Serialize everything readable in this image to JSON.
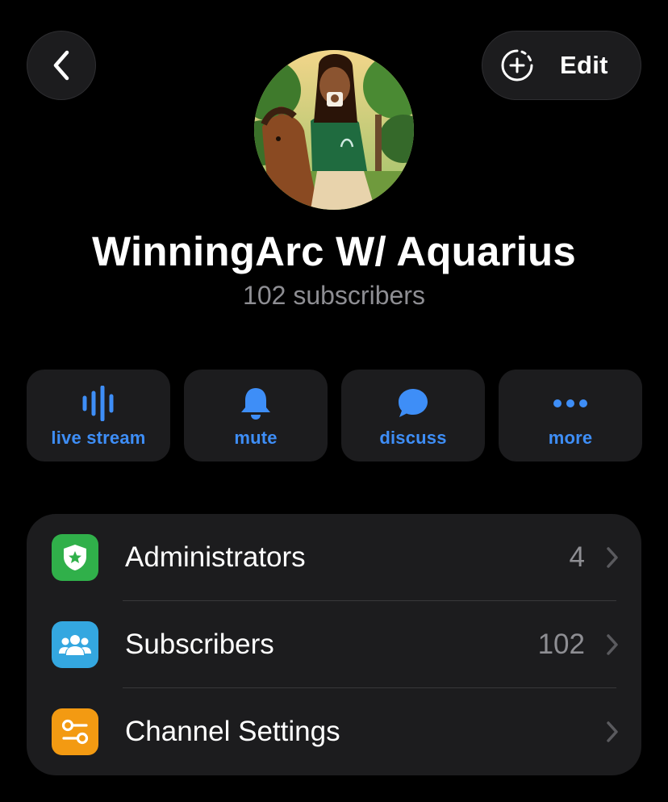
{
  "header": {
    "edit_label": "Edit"
  },
  "channel": {
    "title": "WinningArc W/ Aquarius",
    "subscribers_text": "102 subscribers"
  },
  "actions": [
    {
      "label": "live stream",
      "icon": "live-stream-icon"
    },
    {
      "label": "mute",
      "icon": "bell-icon"
    },
    {
      "label": "discuss",
      "icon": "chat-bubble-icon"
    },
    {
      "label": "more",
      "icon": "more-dots-icon"
    }
  ],
  "list": {
    "items": [
      {
        "label": "Administrators",
        "value": "4",
        "icon": "admin-shield-icon",
        "icon_color": "#30b04a"
      },
      {
        "label": "Subscribers",
        "value": "102",
        "icon": "group-people-icon",
        "icon_color": "#34a7e0"
      },
      {
        "label": "Channel Settings",
        "value": "",
        "icon": "settings-toggle-icon",
        "icon_color": "#f39a12"
      }
    ]
  },
  "colors": {
    "accent": "#3e8ef7",
    "background": "#000000",
    "card": "#1c1c1e",
    "secondary_text": "#8e8e93"
  }
}
